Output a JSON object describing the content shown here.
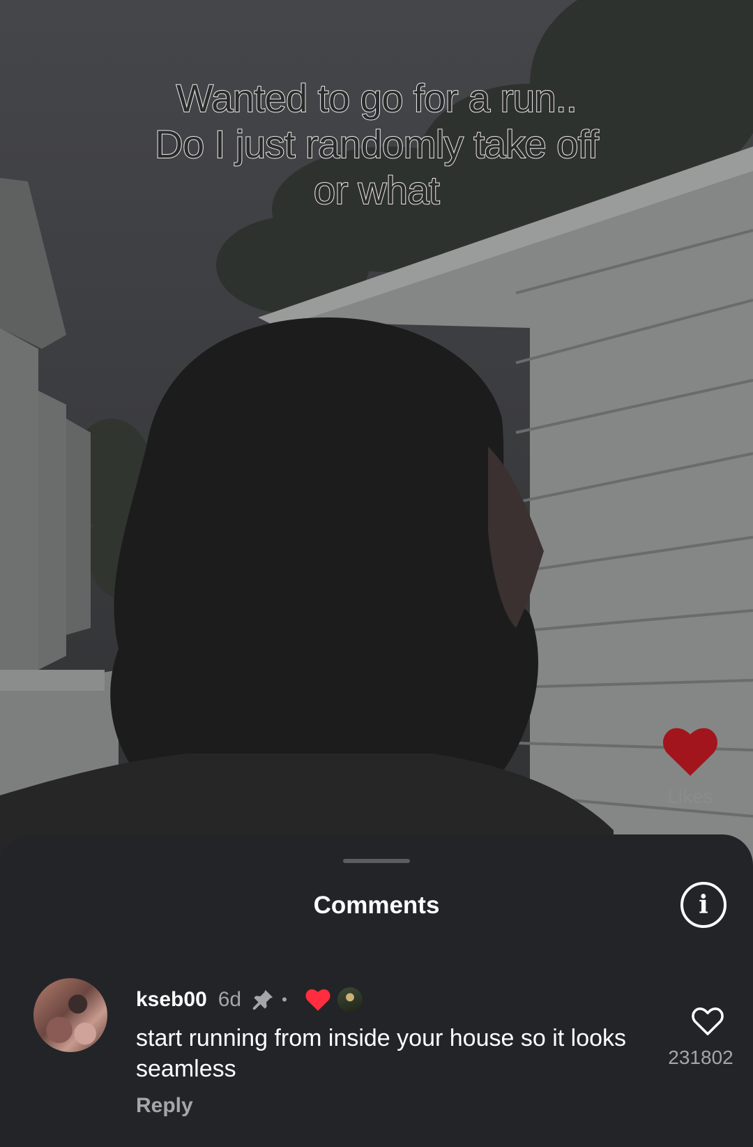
{
  "video": {
    "caption_lines": [
      "Wanted to go for a run..",
      "Do I just randomly take off",
      "or what"
    ],
    "likes_label": "Likes",
    "like_heart_color": "#a3151c"
  },
  "comments_sheet": {
    "title": "Comments",
    "info_icon_glyph": "i",
    "comment": {
      "username": "kseb00",
      "time": "6d",
      "separator": "•",
      "text": "start running from inside your house so it looks seamless",
      "reply_label": "Reply",
      "like_count": "231802",
      "creator_liked_heart_color": "#ff2d3d"
    }
  },
  "colors": {
    "sheet_background": "#222428",
    "text_primary": "#ffffff",
    "text_secondary": "#a4a6aa"
  }
}
